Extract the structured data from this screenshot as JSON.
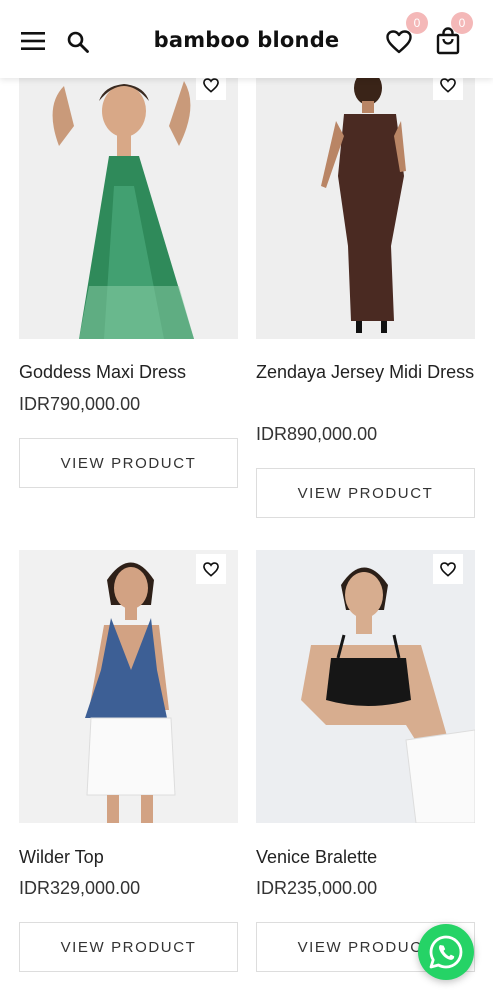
{
  "header": {
    "logo": "bamboo blonde",
    "wishlist_count": "0",
    "cart_count": "0"
  },
  "products": [
    {
      "name": "Goddess Maxi Dress",
      "price": "IDR790,000.00",
      "button": "VIEW PRODUCT"
    },
    {
      "name": "Zendaya Jersey Midi Dress",
      "price": "IDR890,000.00",
      "button": "VIEW PRODUCT"
    },
    {
      "name": "Wilder Top",
      "price": "IDR329,000.00",
      "button": "VIEW PRODUCT"
    },
    {
      "name": "Venice Bralette",
      "price": "IDR235,000.00",
      "button": "VIEW PRODUCT"
    }
  ],
  "icons": [
    "menu-icon",
    "search-icon",
    "heart-icon",
    "shopping-bag-icon",
    "whatsapp-icon"
  ],
  "colors": {
    "badge": "#f4b8b8",
    "whatsapp": "#25d366",
    "border": "#dddddd"
  }
}
